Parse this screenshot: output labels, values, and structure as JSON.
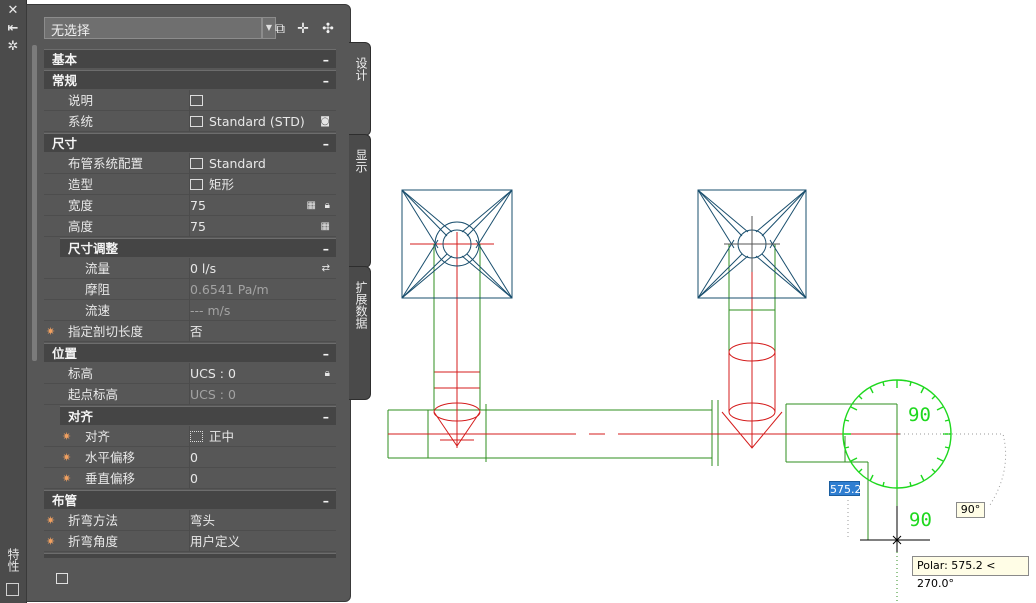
{
  "side_bar": {
    "title": "特性",
    "buttons": [
      "close",
      "pin",
      "settings"
    ]
  },
  "panel": {
    "selector": {
      "value": "无选择"
    },
    "sections": {
      "basic": "基本",
      "general": "常规",
      "size": "尺寸",
      "size_adjust": "尺寸调整",
      "position": "位置",
      "align": "对齐",
      "routing": "布管"
    },
    "rows": {
      "description": {
        "label": "说明"
      },
      "system": {
        "label": "系统",
        "value": "Standard (STD)"
      },
      "routing_pref": {
        "label": "布管系统配置",
        "value": "Standard"
      },
      "shape": {
        "label": "造型",
        "value": "矩形"
      },
      "width": {
        "label": "宽度",
        "value": "75"
      },
      "height": {
        "label": "高度",
        "value": "75"
      },
      "flow": {
        "label": "流量",
        "value": "0 l/s"
      },
      "friction": {
        "label": "摩阻",
        "value": "0.6541 Pa/m"
      },
      "velocity": {
        "label": "流速",
        "value": "--- m/s"
      },
      "cut_length": {
        "label": "指定剖切长度",
        "value": "否"
      },
      "elevation": {
        "label": "标高",
        "value": "UCS : 0"
      },
      "start_elevation": {
        "label": "起点标高",
        "value": "UCS : 0"
      },
      "justify": {
        "label": "对齐",
        "value": "正中"
      },
      "h_offset": {
        "label": "水平偏移",
        "value": "0"
      },
      "v_offset": {
        "label": "垂直偏移",
        "value": "0"
      },
      "bend_method": {
        "label": "折弯方法",
        "value": "弯头"
      },
      "bend_angle": {
        "label": "折弯角度",
        "value": "用户定义"
      }
    }
  },
  "tabs": {
    "design": "设计",
    "display": "显示",
    "extended": "扩展数据"
  },
  "drawing": {
    "length_input": "575.2",
    "angle_tip": "90°",
    "polar_tip": "Polar: 575.2 < 270.0°",
    "compass_label_top": "90",
    "compass_label_bottom": "90"
  },
  "colors": {
    "duct": "#2f8f1f",
    "centerline": "#d41d1d",
    "diffuser": "#1a4f6e",
    "compass": "#1fd81f",
    "selection": "#2f7ed1"
  }
}
